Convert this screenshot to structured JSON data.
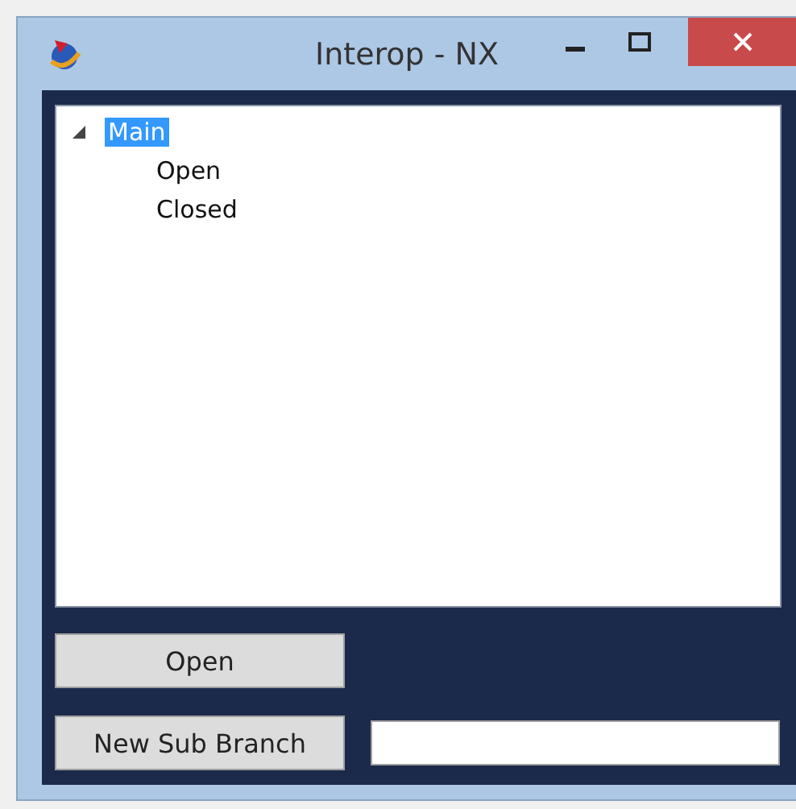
{
  "window": {
    "title": "Interop - NX"
  },
  "tree": {
    "items": [
      {
        "label": "Main",
        "selected": true,
        "expanded": true,
        "children": [
          {
            "label": "Open",
            "selected": false
          },
          {
            "label": "Closed",
            "selected": false
          }
        ]
      }
    ]
  },
  "buttons": [
    {
      "label": "Open"
    },
    {
      "label": "New Sub Branch"
    }
  ]
}
